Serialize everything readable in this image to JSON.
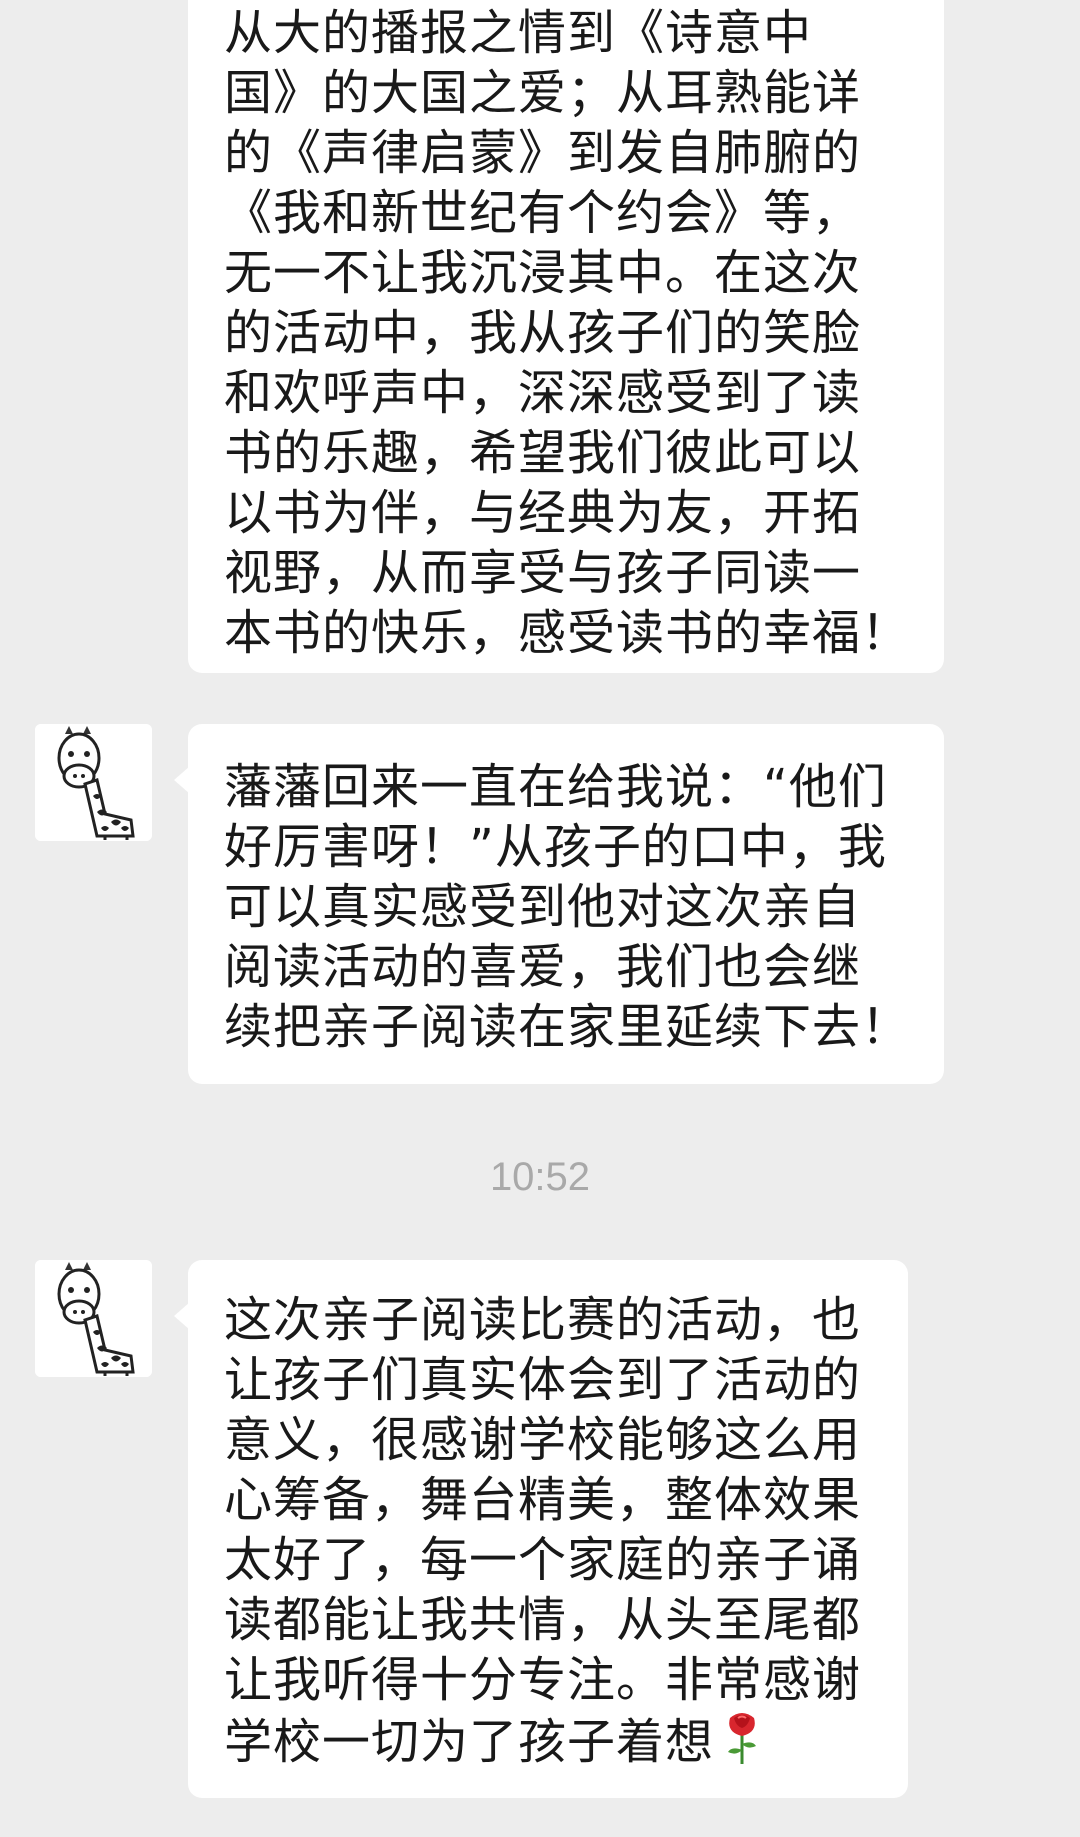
{
  "messages": [
    {
      "lines": [
        "从大的播报之情到《诗意中",
        "国》的大国之爱；从耳熟能详",
        "的《声律启蒙》到发自肺腑的",
        "《我和新世纪有个约会》等，",
        "无一不让我沉浸其中。在这次",
        "的活动中，我从孩子们的笑脸",
        "和欢呼声中，深深感受到了读",
        "书的乐趣，希望我们彼此可以",
        "以书为伴，与经典为友，开拓",
        "视野，从而享受与孩子同读一",
        "本书的快乐，感受读书的幸福！"
      ]
    },
    {
      "lines": [
        "藩藩回来一直在给我说：“他们",
        "好厉害呀！”从孩子的口中，我",
        "可以真实感受到他对这次亲自",
        "阅读活动的喜爱，我们也会继",
        "续把亲子阅读在家里延续下去！"
      ]
    },
    {
      "lines": [
        "这次亲子阅读比赛的活动，也",
        "让孩子们真实体会到了活动的",
        "意义，很感谢学校能够这么用",
        "心筹备，舞台精美，整体效果",
        "太好了，每一个家庭的亲子诵",
        "读都能让我共情，从头至尾都",
        "让我听得十分专注。非常感谢",
        "学校一切为了孩子着想"
      ],
      "trailing_icon": "rose-icon"
    }
  ],
  "timestamp": "10:52",
  "avatar_icon": "giraffe-icon",
  "colors": {
    "background": "#ededed",
    "bubble": "#ffffff",
    "text": "#191919",
    "timestamp": "#a9a9a9"
  }
}
